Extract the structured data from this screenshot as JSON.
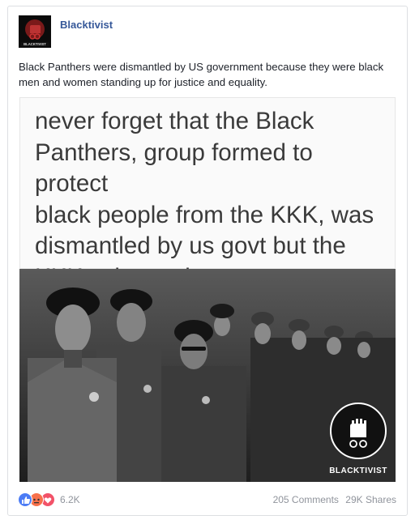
{
  "post": {
    "page_name": "Blacktivist",
    "avatar_caption": "BLACKTIVIST",
    "text": "Black Panthers were dismantled by US government because they were black men and women standing up for justice and equality."
  },
  "image": {
    "quote": "never forget that the Black\nPanthers, group formed to protect\nblack people from the KKK, was\ndismantled by us govt but the\nKKK exists today",
    "watermark": "BLACKTIVIST"
  },
  "footer": {
    "reactions": [
      "like-icon",
      "angry-icon",
      "love-icon"
    ],
    "reaction_count": "6.2K",
    "comments": "205 Comments",
    "shares": "29K Shares"
  },
  "colors": {
    "link_blue": "#365899",
    "like_blue": "#4c7cf5",
    "angry_orange": "#f7714c",
    "love_red": "#f25268",
    "meta_gray": "#90949c"
  }
}
